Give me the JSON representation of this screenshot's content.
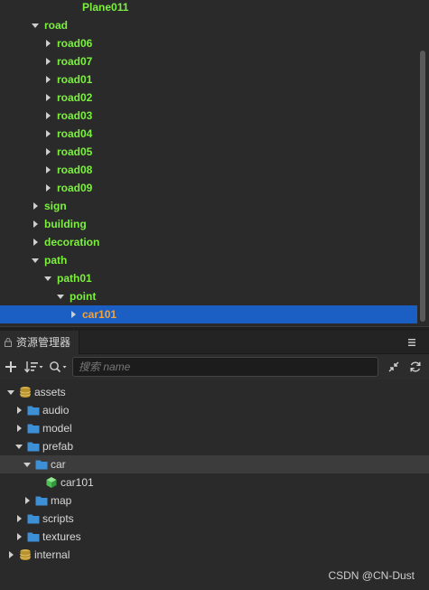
{
  "hierarchy": {
    "rows": [
      {
        "label": "Plane011",
        "expand": "none"
      },
      {
        "label": "road",
        "expand": "down"
      },
      {
        "label": "road06",
        "expand": "right"
      },
      {
        "label": "road07",
        "expand": "right"
      },
      {
        "label": "road01",
        "expand": "right"
      },
      {
        "label": "road02",
        "expand": "right"
      },
      {
        "label": "road03",
        "expand": "right"
      },
      {
        "label": "road04",
        "expand": "right"
      },
      {
        "label": "road05",
        "expand": "right"
      },
      {
        "label": "road08",
        "expand": "right"
      },
      {
        "label": "road09",
        "expand": "right"
      },
      {
        "label": "sign",
        "expand": "right"
      },
      {
        "label": "building",
        "expand": "right"
      },
      {
        "label": "decoration",
        "expand": "right"
      },
      {
        "label": "path",
        "expand": "down"
      },
      {
        "label": "path01",
        "expand": "down"
      },
      {
        "label": "point",
        "expand": "down"
      },
      {
        "label": "car101",
        "expand": "right",
        "selected": true
      }
    ]
  },
  "assets_panel": {
    "tab_label": "资源管理器",
    "search_placeholder": "搜索 name",
    "tree": [
      {
        "label": "assets",
        "icon": "database-icon",
        "expand": "down"
      },
      {
        "label": "audio",
        "icon": "folder-icon",
        "expand": "right"
      },
      {
        "label": "model",
        "icon": "folder-icon",
        "expand": "right"
      },
      {
        "label": "prefab",
        "icon": "folder-icon",
        "expand": "down"
      },
      {
        "label": "car",
        "icon": "folder-icon",
        "expand": "down",
        "highlight": true
      },
      {
        "label": "car101",
        "icon": "prefab-cube-icon",
        "expand": "none"
      },
      {
        "label": "map",
        "icon": "folder-icon",
        "expand": "right"
      },
      {
        "label": "scripts",
        "icon": "folder-icon",
        "expand": "right"
      },
      {
        "label": "textures",
        "icon": "folder-icon",
        "expand": "right"
      },
      {
        "label": "internal",
        "icon": "database-icon",
        "expand": "right"
      }
    ]
  },
  "watermark": "CSDN @CN-Dust",
  "colors": {
    "node_label": "#7cf03f",
    "selected_bg": "#1c5fc4",
    "selected_label": "#f2a33a",
    "folder": "#3d8fd6",
    "database": "#d6b24a",
    "prefab": "#5fcf6a"
  }
}
